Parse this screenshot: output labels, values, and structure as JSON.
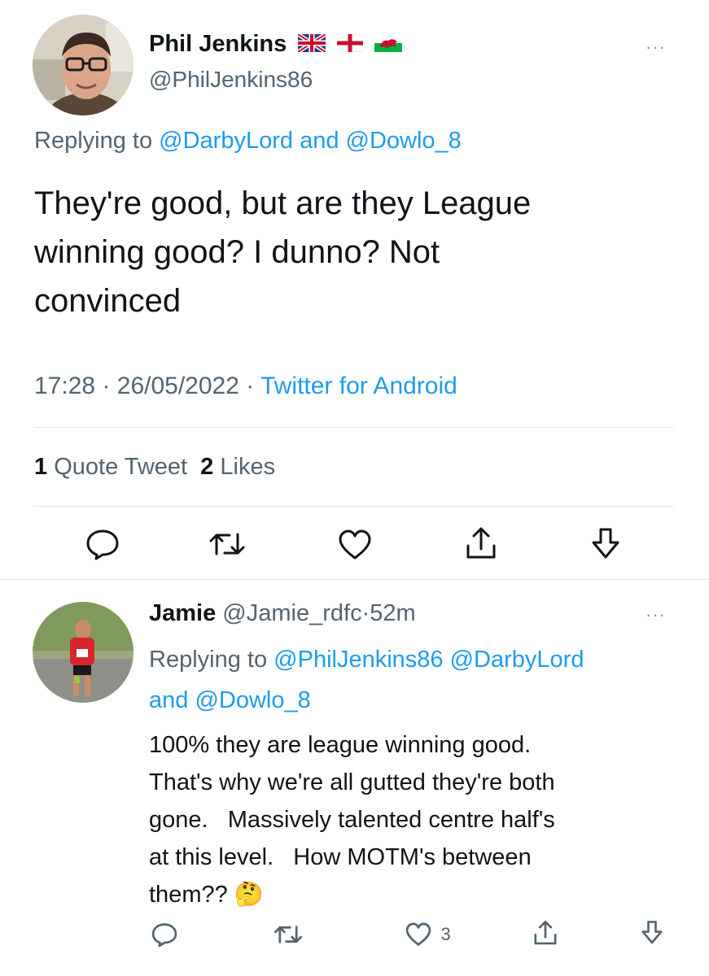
{
  "main_tweet": {
    "display_name": "Phil Jenkins",
    "flag_icons": [
      "union-jack-flag-icon",
      "england-flag-icon",
      "wales-flag-icon"
    ],
    "handle": "@PhilJenkins86",
    "replying_prefix": "Replying to",
    "replying_user_1": "@DarbyLord",
    "replying_and": "and",
    "replying_user_2": "@Dowlo_8",
    "text_line_1": "They're good, but are they League",
    "text_line_2": "winning good? I dunno? Not",
    "text_line_3": "convinced",
    "time": "17:28",
    "separator": "·",
    "date": "26/05/2022",
    "source": "Twitter for Android",
    "quote_count": "1",
    "quote_label": "Quote Tweet",
    "like_count": "2",
    "like_label": "Likes",
    "more_label": "···"
  },
  "reply": {
    "display_name": "Jamie",
    "handle": "@Jamie_rdfc",
    "separator": "·",
    "time_ago": "52m",
    "replying_prefix": "Replying to",
    "replying_user_1": "@PhilJenkins86",
    "replying_user_2": "@DarbyLord",
    "replying_and": "and",
    "replying_user_3": "@Dowlo_8",
    "text_line_1": "100% they are league winning good.",
    "text_line_2": "That's why we're all gutted they're both",
    "text_line_3": "gone.   Massively talented centre half's",
    "text_line_4": "at this level.   How MOTM's between",
    "text_line_5": "them??",
    "emoji": "🤔",
    "like_count": "3",
    "more_label": "···"
  },
  "colors": {
    "text": "#0f1419",
    "muted": "#536471",
    "link": "#1d9bf0",
    "divider": "#e3e6e9"
  }
}
